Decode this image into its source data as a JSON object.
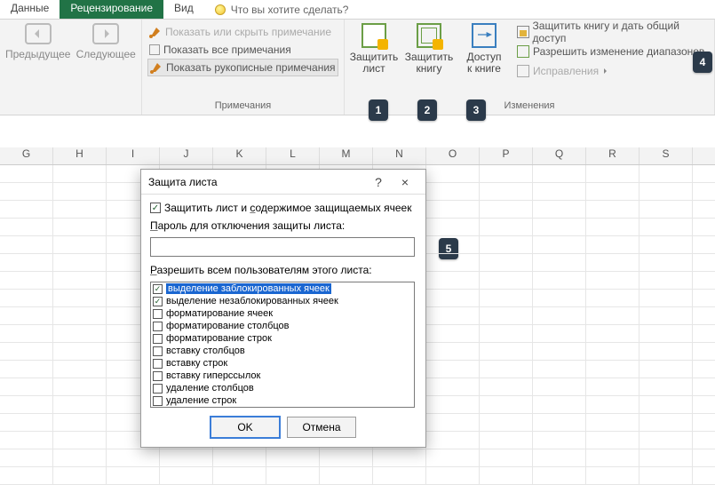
{
  "tabs": {
    "data": "Данные",
    "review": "Рецензирование",
    "view": "Вид",
    "tell_me": "Что вы хотите сделать?"
  },
  "ribbon": {
    "prev": "Предыдущее",
    "next": "Следующее",
    "notes_show_hide": "Показать или скрыть примечание",
    "notes_show_all": "Показать все примечания",
    "notes_show_ink": "Показать рукописные примечания",
    "notes_group": "Примечания",
    "protect_sheet_l1": "Защитить",
    "protect_sheet_l2": "лист",
    "protect_book_l1": "Защитить",
    "protect_book_l2": "книгу",
    "share_book_l1": "Доступ",
    "share_book_l2": "к книге",
    "protect_share": "Защитить книгу и дать общий доступ",
    "allow_ranges": "Разрешить изменение диапазонов",
    "track_changes": "Исправления",
    "changes_group": "Изменения"
  },
  "badges": {
    "b1": "1",
    "b2": "2",
    "b3": "3",
    "b4": "4",
    "b5": "5"
  },
  "columns": [
    "G",
    "H",
    "I",
    "J",
    "K",
    "L",
    "M",
    "N",
    "O",
    "P",
    "Q",
    "R",
    "S"
  ],
  "dialog": {
    "title": "Защита листа",
    "help": "?",
    "close": "×",
    "protect_label_pre": "Защитить лист и ",
    "protect_label_und": "с",
    "protect_label_post": "одержимое защищаемых ячеек",
    "password_label_pre": "",
    "password_label_und": "П",
    "password_label_post": "ароль для отключения защиты листа:",
    "password_value": "",
    "permlabel_pre": "",
    "permlabel_und": "Р",
    "permlabel_post": "азрешить всем пользователям этого листа:",
    "permissions": [
      {
        "label": "выделение заблокированных ячеек",
        "checked": true,
        "selected": true
      },
      {
        "label": "выделение незаблокированных ячеек",
        "checked": true,
        "selected": false
      },
      {
        "label": "форматирование ячеек",
        "checked": false,
        "selected": false
      },
      {
        "label": "форматирование столбцов",
        "checked": false,
        "selected": false
      },
      {
        "label": "форматирование строк",
        "checked": false,
        "selected": false
      },
      {
        "label": "вставку столбцов",
        "checked": false,
        "selected": false
      },
      {
        "label": "вставку строк",
        "checked": false,
        "selected": false
      },
      {
        "label": "вставку гиперссылок",
        "checked": false,
        "selected": false
      },
      {
        "label": "удаление столбцов",
        "checked": false,
        "selected": false
      },
      {
        "label": "удаление строк",
        "checked": false,
        "selected": false
      }
    ],
    "ok": "OK",
    "cancel": "Отмена"
  }
}
